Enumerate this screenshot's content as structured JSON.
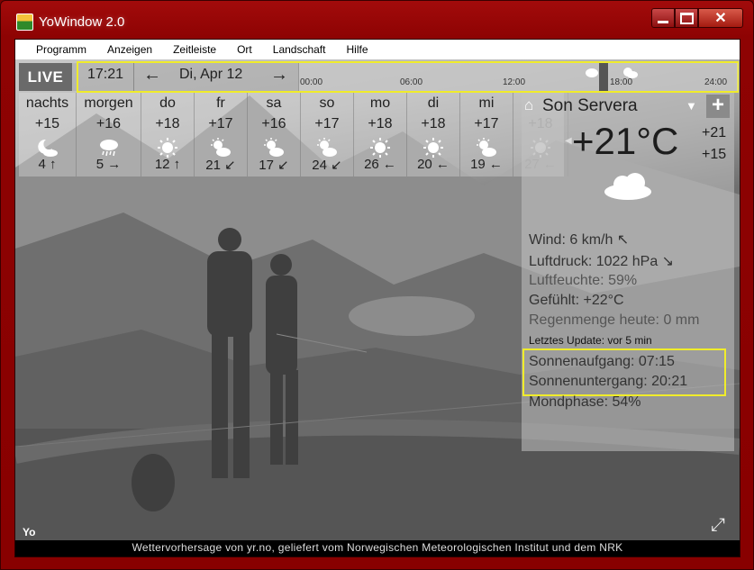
{
  "window": {
    "title": "YoWindow 2.0",
    "accent": "#8b0000"
  },
  "menu": [
    "Programm",
    "Anzeigen",
    "Zeitleiste",
    "Ort",
    "Landschaft",
    "Hilfe"
  ],
  "timeline": {
    "live_label": "LIVE",
    "time": "17:21",
    "date": "Di, Apr 12",
    "prev_arrow": "←",
    "next_arrow": "→",
    "ticks": [
      "00:00",
      "06:00",
      "12:00",
      "18:00",
      "24:00"
    ],
    "highlight_color": "#f0ec2a"
  },
  "forecast": [
    {
      "day": "nachts",
      "temp": "+15",
      "icon": "moon-cloud-icon",
      "wind": "4 ↑"
    },
    {
      "day": "morgen",
      "temp": "+16",
      "icon": "rain-cloud-icon",
      "wind": "5 →"
    },
    {
      "day": "do",
      "temp": "+18",
      "icon": "sun-icon",
      "wind": "12 ↑"
    },
    {
      "day": "fr",
      "temp": "+17",
      "icon": "sun-cloud-icon",
      "wind": "21 ↙"
    },
    {
      "day": "sa",
      "temp": "+16",
      "icon": "sun-cloud-icon",
      "wind": "17 ↙"
    },
    {
      "day": "so",
      "temp": "+17",
      "icon": "sun-cloud-icon",
      "wind": "24 ↙"
    },
    {
      "day": "mo",
      "temp": "+18",
      "icon": "sun-icon",
      "wind": "26 ←"
    },
    {
      "day": "di",
      "temp": "+18",
      "icon": "sun-icon",
      "wind": "20 ←"
    },
    {
      "day": "mi",
      "temp": "+17",
      "icon": "sun-cloud-icon",
      "wind": "19 ←"
    },
    {
      "day": "",
      "temp": "+18",
      "icon": "sun-icon",
      "wind": "27 ←",
      "faded": true
    }
  ],
  "current": {
    "location": "Son Servera",
    "dropdown": "▼",
    "add": "+",
    "temperature": "+21°C",
    "high": "+21",
    "low": "+15",
    "icon": "cloud-icon",
    "wind": "Wind:  6 km/h ↖",
    "pressure": "Luftdruck:  1022 hPa  ↘",
    "humidity": "Luftfeuchte:  59%",
    "feels_like": "Gefühlt:  +22°C",
    "rain": "Regenmenge heute:  0 mm",
    "last_update": "Letztes Update:  vor 5 min",
    "sunrise": "Sonnenaufgang:  07:15",
    "sunset": "Sonnenuntergang:  20:21",
    "moon": "Mondphase:  54%"
  },
  "badge": "Yo",
  "footer": "Wettervorhersage von yr.no, geliefert vom Norwegischen Meteorologischen Institut und dem NRK"
}
